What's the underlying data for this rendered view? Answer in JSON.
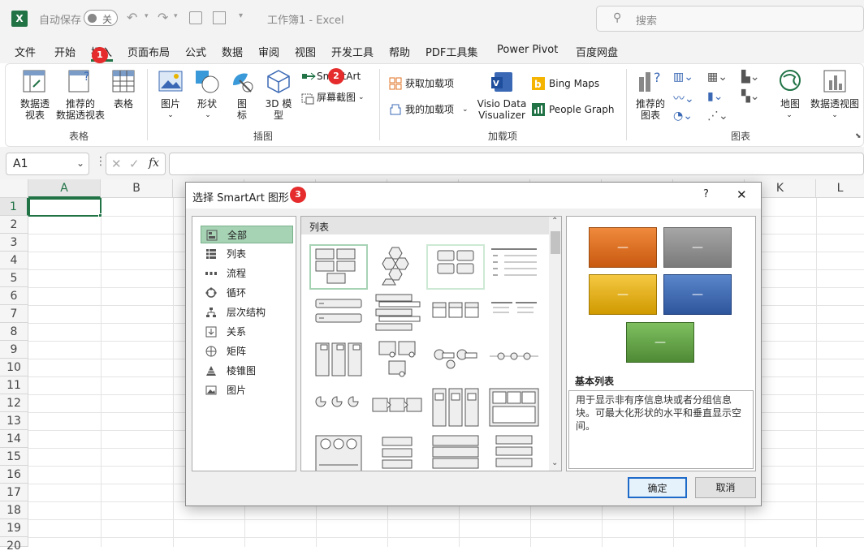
{
  "titlebar": {
    "autosave_label": "自动保存",
    "autosave_state": "关",
    "doc_title": "工作簿1  -  Excel",
    "search_placeholder": "搜索"
  },
  "tabs": [
    "文件",
    "开始",
    "插入",
    "页面布局",
    "公式",
    "数据",
    "审阅",
    "视图",
    "开发工具",
    "帮助",
    "PDF工具集",
    "Power Pivot",
    "百度网盘"
  ],
  "ribbon": {
    "pivot_table": "数据透\n视表",
    "recommended_pivot": "推荐的\n数据透视表",
    "table": "表格",
    "group_tables": "表格",
    "pictures": "图片",
    "shapes": "形状",
    "icons": "图\n标",
    "models3d": "3D 模\n型",
    "smartart": "SmartArt",
    "screenshot": "屏幕截图",
    "group_illustrations": "插图",
    "get_addins": "获取加载项",
    "my_addins": "我的加载项",
    "visio": "Visio Data\nVisualizer",
    "bing_maps": "Bing Maps",
    "people_graph": "People Graph",
    "group_addins": "加载项",
    "recommended_charts": "推荐的\n图表",
    "maps": "地图",
    "pivot_chart": "数据透视图",
    "group_charts": "图表"
  },
  "formula_bar": {
    "name_box": "A1",
    "fx": "fx"
  },
  "sheet": {
    "columns": [
      "A",
      "B",
      "C",
      "D",
      "E",
      "F",
      "G",
      "H",
      "I",
      "J",
      "K",
      "L"
    ],
    "rows": [
      "1",
      "2",
      "3",
      "4",
      "5",
      "6",
      "7",
      "8",
      "9",
      "10",
      "11",
      "12",
      "13",
      "14",
      "15",
      "16",
      "17",
      "18",
      "19",
      "20"
    ]
  },
  "badges": [
    "1",
    "2",
    "3"
  ],
  "dialog": {
    "title": "选择 SmartArt 图形",
    "help": "?",
    "close": "✕",
    "categories": [
      "全部",
      "列表",
      "流程",
      "循环",
      "层次结构",
      "关系",
      "矩阵",
      "棱锥图",
      "图片"
    ],
    "selected_category": "全部",
    "gallery_header": "列表",
    "preview_title": "基本列表",
    "preview_desc": "用于显示非有序信息块或者分组信息块。可最大化形状的水平和垂直显示空间。",
    "preview_shape_text": "—",
    "ok": "确定",
    "cancel": "取消"
  },
  "colors": {
    "excel_green": "#217346",
    "accent_red": "#e52b2b",
    "orange": "#e07020",
    "gray": "#8c8c8c",
    "yellow": "#e8b400",
    "blue": "#3a68b4",
    "green": "#6aa84f"
  }
}
